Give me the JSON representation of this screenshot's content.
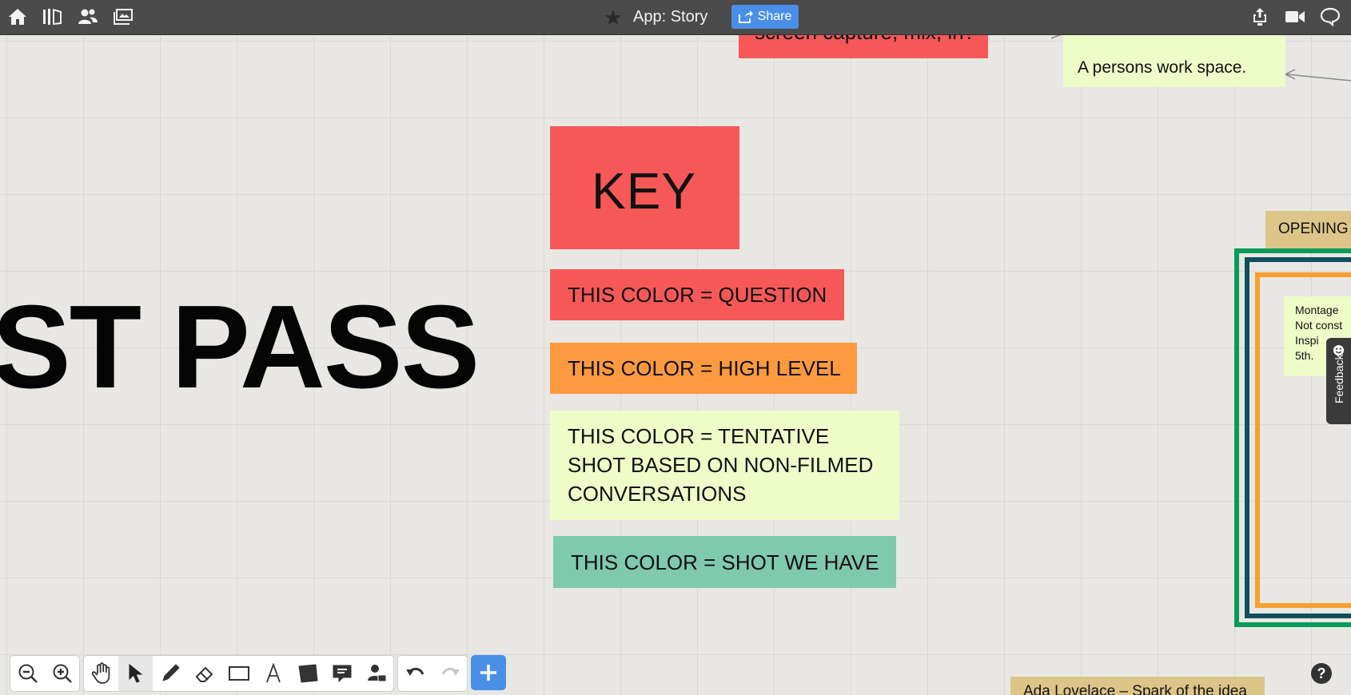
{
  "topbar": {
    "title": "App: Story",
    "share_label": "Share"
  },
  "canvas": {
    "big_title": "ST PASS",
    "top_red_note": "screen capture, mix, in?",
    "top_lime_note": "A persons work space.",
    "key_note": "KEY",
    "legend": [
      {
        "label": "THIS COLOR = QUESTION",
        "color": "#f65858"
      },
      {
        "label": "THIS COLOR = HIGH LEVEL",
        "color": "#fd9a40"
      },
      {
        "label_lines": [
          "THIS COLOR = TENTATIVE",
          "SHOT BASED ON NON-FILMED",
          "CONVERSATIONS"
        ],
        "color": "#eefcc8"
      },
      {
        "label": "THIS COLOR = SHOT WE HAVE",
        "color": "#7fc9ae"
      }
    ],
    "opening_note": "OPENING",
    "montage_note_lines": [
      "Montage",
      "Not const",
      "Inspi",
      "5th."
    ],
    "bottom_tan_note": "Ada Lovelace – Spark of the idea",
    "frame_colors": {
      "outer": "#0a9a5a",
      "middle": "#0f4f5e",
      "inner": "#f7a030"
    }
  },
  "feedback": {
    "label": "Feedback"
  },
  "help": {
    "label": "?"
  }
}
